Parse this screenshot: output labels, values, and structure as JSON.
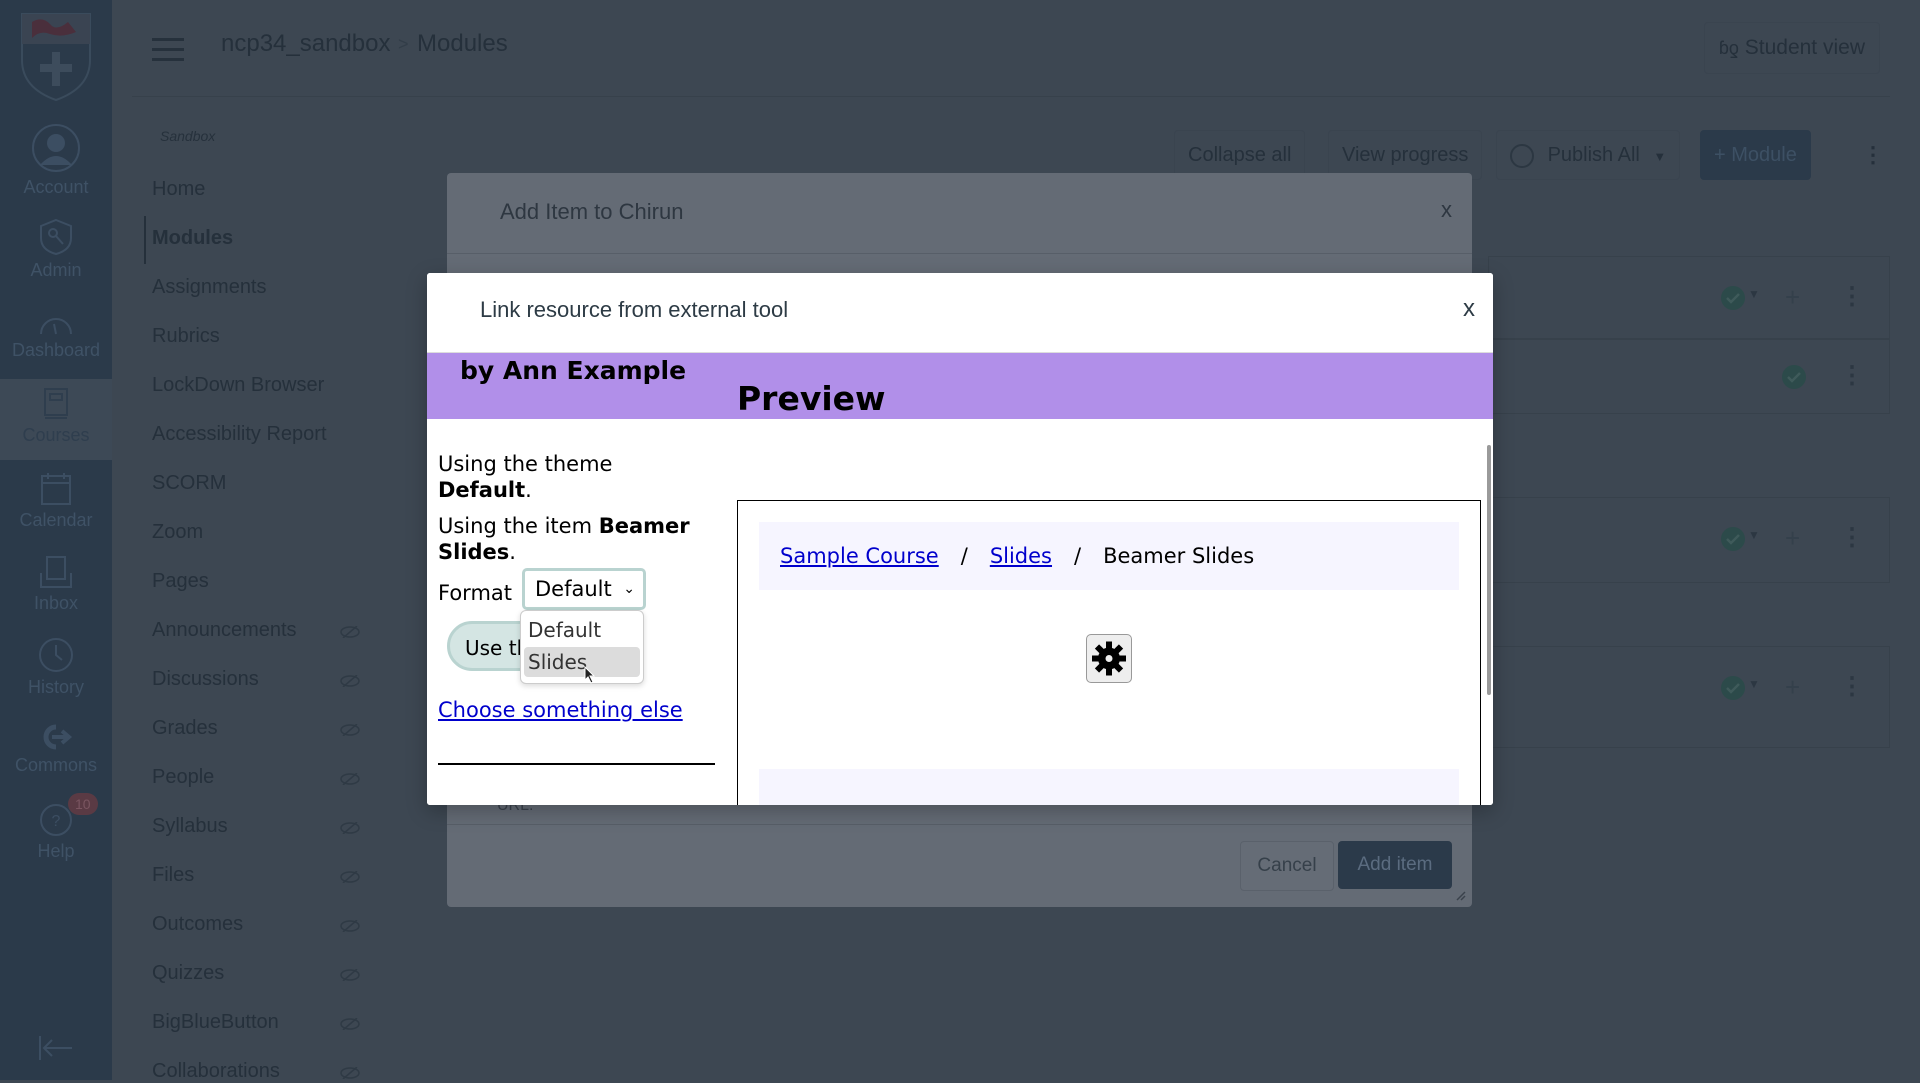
{
  "global_nav": {
    "items": [
      {
        "label": "Account",
        "icon": "account-avatar-icon"
      },
      {
        "label": "Admin",
        "icon": "admin-shield-icon"
      },
      {
        "label": "Dashboard",
        "icon": "dashboard-gauge-icon"
      },
      {
        "label": "Courses",
        "icon": "courses-book-icon",
        "active": true
      },
      {
        "label": "Calendar",
        "icon": "calendar-icon"
      },
      {
        "label": "Inbox",
        "icon": "inbox-icon"
      },
      {
        "label": "History",
        "icon": "history-clock-icon"
      },
      {
        "label": "Commons",
        "icon": "commons-icon"
      },
      {
        "label": "Help",
        "icon": "help-icon",
        "badge": "10"
      }
    ],
    "collapse_icon": "collapse-arrow-icon"
  },
  "header": {
    "course": "ncp34_sandbox",
    "separator": ">",
    "page": "Modules",
    "student_view": "Student view"
  },
  "course_nav": {
    "subtitle": "Sandbox",
    "items": [
      {
        "label": "Home",
        "hidden": false
      },
      {
        "label": "Modules",
        "hidden": false,
        "active": true
      },
      {
        "label": "Assignments",
        "hidden": false
      },
      {
        "label": "Rubrics",
        "hidden": false
      },
      {
        "label": "LockDown Browser",
        "hidden": false
      },
      {
        "label": "Accessibility Report",
        "hidden": false
      },
      {
        "label": "SCORM",
        "hidden": false
      },
      {
        "label": "Zoom",
        "hidden": false
      },
      {
        "label": "Pages",
        "hidden": false
      },
      {
        "label": "Announcements",
        "hidden": true
      },
      {
        "label": "Discussions",
        "hidden": true
      },
      {
        "label": "Grades",
        "hidden": true
      },
      {
        "label": "People",
        "hidden": true
      },
      {
        "label": "Syllabus",
        "hidden": true
      },
      {
        "label": "Files",
        "hidden": true
      },
      {
        "label": "Outcomes",
        "hidden": true
      },
      {
        "label": "Quizzes",
        "hidden": true
      },
      {
        "label": "BigBlueButton",
        "hidden": true
      },
      {
        "label": "Collaborations",
        "hidden": true
      }
    ]
  },
  "toolbar": {
    "collapse_all": "Collapse all",
    "view_progress": "View progress",
    "publish_all": "Publish All",
    "add_module": "+ Module"
  },
  "outer_dialog": {
    "title": "Add Item to Chirun",
    "close": "x",
    "url_label": "URL:",
    "cancel": "Cancel",
    "add_item": "Add item"
  },
  "inner_dialog": {
    "title": "Link resource from external tool",
    "close": "x",
    "author": "by Ann Example",
    "theme_prefix": "Using the theme ",
    "theme_name": "Default",
    "item_prefix": "Using the item ",
    "item_name": "Beamer Slides",
    "period": ".",
    "format_label": "Format",
    "format_value": "Default",
    "format_options": [
      "Default",
      "Slides"
    ],
    "format_highlighted": "Slides",
    "use_button": "Use this",
    "choose_else": "Choose something else",
    "preview_heading": "Preview",
    "preview": {
      "breadcrumb": [
        {
          "label": "Sample Course",
          "link": true
        },
        {
          "label": "Slides",
          "link": true
        },
        {
          "label": "Beamer Slides",
          "link": false
        }
      ],
      "separator": "/",
      "settings_icon": "gear-icon"
    }
  },
  "colors": {
    "band": "#b18fe9",
    "link": "#0000cc",
    "button_border": "#b9d3d0",
    "preview_bg": "#f6f5ff"
  }
}
